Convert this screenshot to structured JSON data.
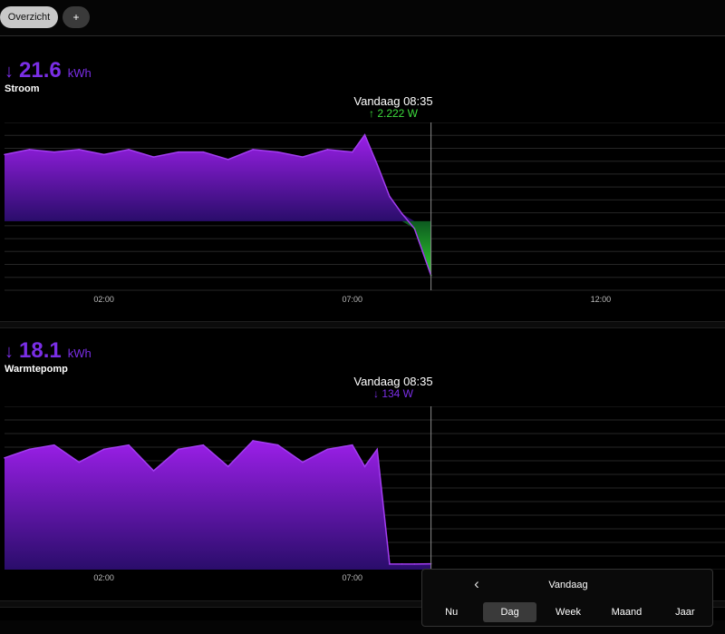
{
  "tabs": {
    "overview": "Overzicht",
    "add": "+"
  },
  "panels": [
    {
      "arrow": "↓",
      "total": "21.6",
      "unit": "kWh",
      "label": "Stroom",
      "cursor_time": "Vandaag 08:35",
      "cursor_arrow": "↑",
      "cursor_value": "2.222 W",
      "x_ticks": [
        "02:00",
        "07:00",
        "12:00"
      ]
    },
    {
      "arrow": "↓",
      "total": "18.1",
      "unit": "kWh",
      "label": "Warmtepomp",
      "cursor_time": "Vandaag 08:35",
      "cursor_arrow": "↓",
      "cursor_value": "134 W",
      "x_ticks": [
        "02:00",
        "07:00"
      ]
    }
  ],
  "nav": {
    "back_icon": "chevron-left-icon",
    "title": "Vandaag",
    "periods": [
      "Nu",
      "Dag",
      "Week",
      "Maand",
      "Jaar"
    ],
    "active_period": "Dag"
  },
  "colors": {
    "accent": "#7a2ee6",
    "positive": "#3ddc3d",
    "background": "#000000"
  },
  "chart_data": [
    {
      "type": "area",
      "title": "",
      "xlabel": "",
      "ylabel": "",
      "x": [
        "00:00",
        "00:30",
        "01:00",
        "01:30",
        "02:00",
        "02:30",
        "03:00",
        "03:30",
        "04:00",
        "04:30",
        "05:00",
        "05:30",
        "06:00",
        "06:30",
        "07:00",
        "07:15",
        "07:30",
        "07:45",
        "08:00",
        "08:15",
        "08:35"
      ],
      "series": [
        {
          "values": [
            2.7,
            2.9,
            2.8,
            2.9,
            2.7,
            2.9,
            2.6,
            2.8,
            2.8,
            2.5,
            2.9,
            2.8,
            2.6,
            2.9,
            2.8,
            3.5,
            2.3,
            1.0,
            0.3,
            -0.3,
            -2.2
          ]
        }
      ],
      "x_ticks": [
        "02:00",
        "07:00",
        "12:00"
      ],
      "xlim": [
        "00:00",
        "14:30"
      ],
      "grid": true
    },
    {
      "type": "area",
      "title": "",
      "xlabel": "",
      "ylabel": "",
      "x": [
        "00:00",
        "00:30",
        "01:00",
        "01:30",
        "02:00",
        "02:30",
        "03:00",
        "03:30",
        "04:00",
        "04:30",
        "05:00",
        "05:30",
        "06:00",
        "06:30",
        "07:00",
        "07:15",
        "07:30",
        "07:45",
        "08:00",
        "08:15",
        "08:35"
      ],
      "series": [
        {
          "values": [
            2.6,
            2.8,
            2.9,
            2.5,
            2.8,
            2.9,
            2.3,
            2.8,
            2.9,
            2.4,
            3.0,
            2.9,
            2.5,
            2.8,
            2.9,
            2.4,
            2.8,
            0.13,
            0.13,
            0.13,
            0.134
          ]
        }
      ],
      "x_ticks": [
        "02:00",
        "07:00"
      ],
      "xlim": [
        "00:00",
        "14:30"
      ],
      "grid": true
    }
  ]
}
